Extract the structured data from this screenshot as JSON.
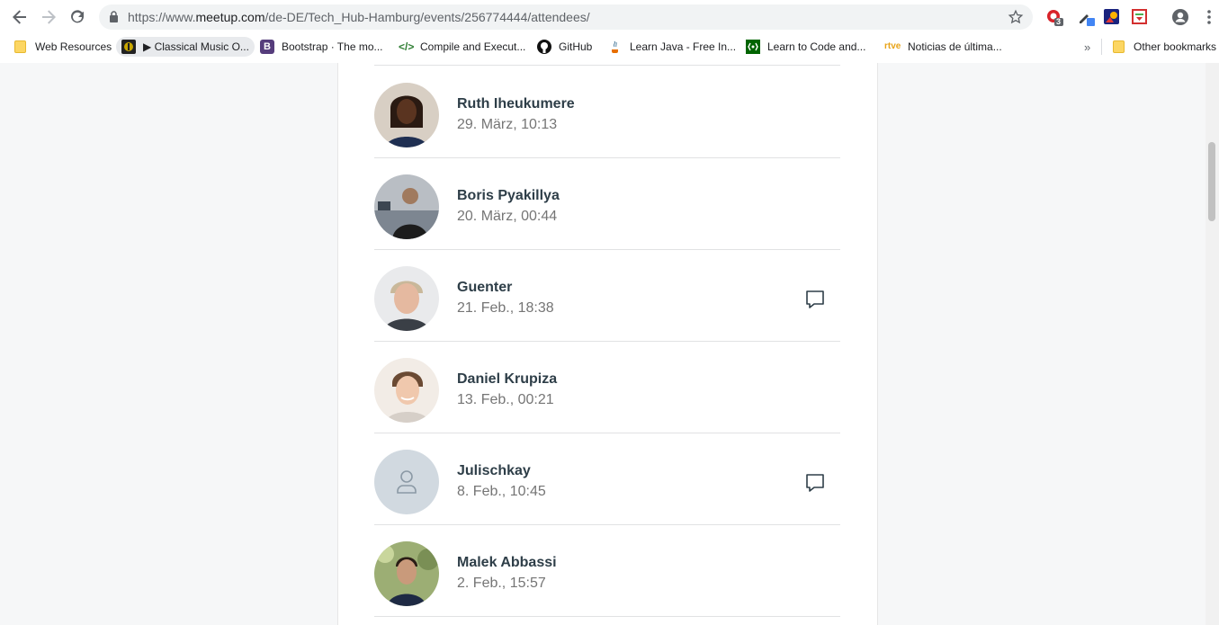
{
  "browser": {
    "url_prefix": "https://www.",
    "url_host": "meetup.com",
    "url_path": "/de-DE/Tech_Hub-Hamburg/events/256774444/attendees/",
    "extension_badge": "3"
  },
  "bookmarks": {
    "items": [
      {
        "label": "Web Resources",
        "icon": "folder-icon"
      },
      {
        "label": "▶ Classical Music O...",
        "icon": "classical-music-icon"
      },
      {
        "label": "Bootstrap · The mo...",
        "icon": "bootstrap-icon"
      },
      {
        "label": "Compile and Execut...",
        "icon": "code-icon"
      },
      {
        "label": "GitHub",
        "icon": "github-icon"
      },
      {
        "label": "Learn Java - Free In...",
        "icon": "java-icon"
      },
      {
        "label": "Learn to Code and...",
        "icon": "freecodecamp-icon"
      },
      {
        "label": "Noticias de última...",
        "icon": "rtve-icon"
      }
    ],
    "overflow": "»",
    "other": "Other bookmarks"
  },
  "attendees": [
    {
      "name": "Ruth Iheukumere",
      "time": "29. März, 10:13",
      "message": false
    },
    {
      "name": "Boris Pyakillya",
      "time": "20. März, 00:44",
      "message": false
    },
    {
      "name": "Guenter",
      "time": "21. Feb., 18:38",
      "message": true
    },
    {
      "name": "Daniel Krupiza",
      "time": "13. Feb., 00:21",
      "message": false
    },
    {
      "name": "Julischkay",
      "time": "8. Feb., 10:45",
      "message": true
    },
    {
      "name": "Malek Abbassi",
      "time": "2. Feb., 15:57",
      "message": false
    }
  ],
  "colors": {
    "page_bg": "#f6f7f8",
    "name_text": "#2e3e48",
    "time_text": "#757575"
  }
}
